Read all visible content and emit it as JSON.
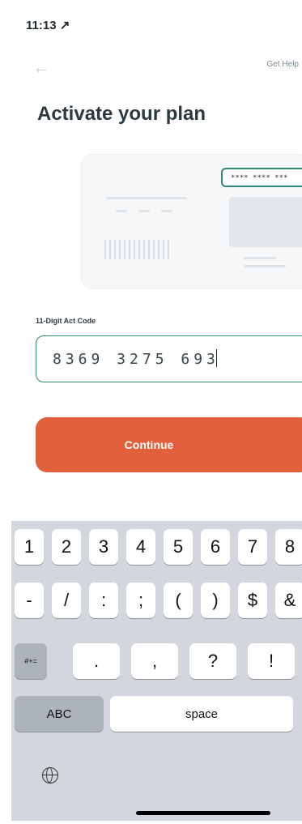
{
  "status_bar": {
    "time": "11:13 ↗"
  },
  "header": {
    "back_icon": "arrow-left-icon",
    "help_label": "Get Help"
  },
  "page": {
    "title": "Activate your plan"
  },
  "illustration": {
    "pill_text": "**** **** ***"
  },
  "form": {
    "label": "11-Digit Act Code",
    "value": "8369 3275 693",
    "accent_color": "#2d8a78"
  },
  "cta": {
    "label": "Continue",
    "color": "#e2603b"
  },
  "keyboard": {
    "row1": [
      "1",
      "2",
      "3",
      "4",
      "5",
      "6",
      "7",
      "8"
    ],
    "row2": [
      "-",
      "/",
      ":",
      ";",
      "(",
      ")",
      "$",
      "&"
    ],
    "row3": [
      ".",
      ",",
      "?",
      "!"
    ],
    "symbols_key": "#+=",
    "abc_key": "ABC",
    "space_key": "space",
    "globe_icon": "globe-icon"
  }
}
